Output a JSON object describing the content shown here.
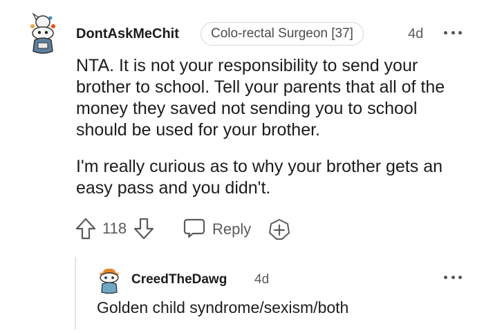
{
  "comment": {
    "username": "DontAskMeChit",
    "flair": "Colo-rectal Surgeon [37]",
    "timestamp": "4d",
    "paragraphs": [
      "NTA. It is not your responsibility to send your brother to school. Tell your parents that all of the money they saved not sending you to school should be used for your brother.",
      "I'm really curious as to why your brother gets an easy pass and you didn't."
    ],
    "score": "118",
    "reply_label": "Reply"
  },
  "reply": {
    "username": "CreedTheDawg",
    "timestamp": "4d",
    "text": "Golden child syndrome/sexism/both"
  },
  "colors": {
    "text": "#1c1c1c",
    "meta": "#5a5a5a",
    "border": "#d6d6d6",
    "thread_line": "#e4e4e4"
  },
  "icons": {
    "upvote": "upvote-arrow-icon",
    "downvote": "downvote-arrow-icon",
    "reply": "speech-bubble-icon",
    "award": "award-plus-icon",
    "more": "ellipsis-icon"
  }
}
